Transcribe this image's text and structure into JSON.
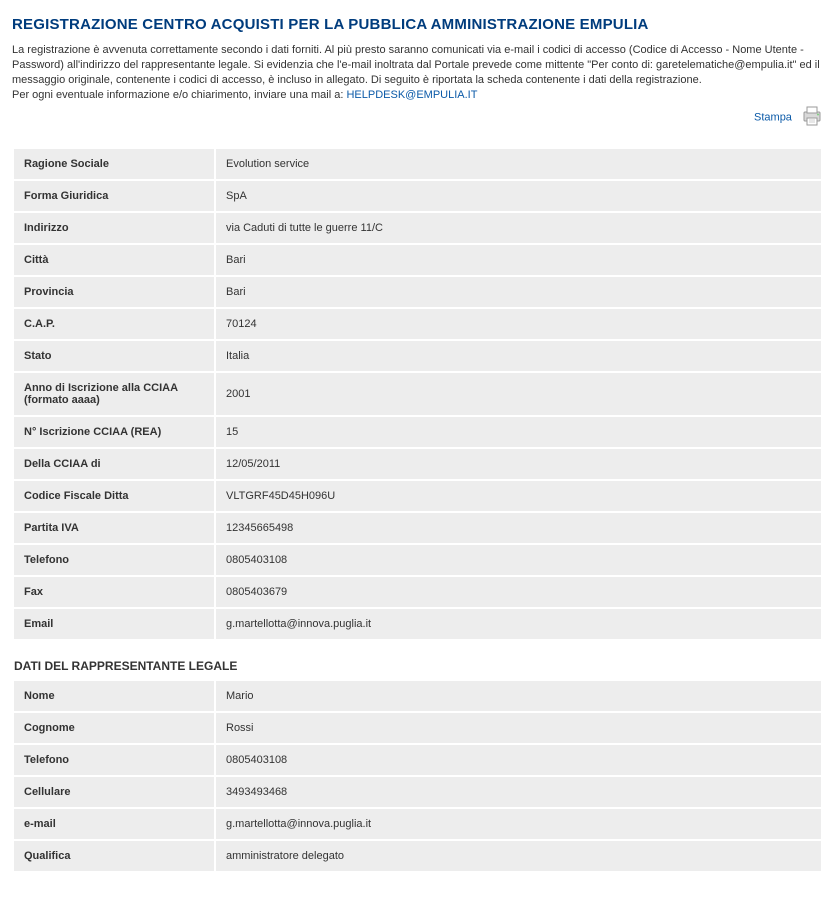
{
  "title": "REGISTRAZIONE CENTRO ACQUISTI PER LA PUBBLICA AMMINISTRAZIONE EMPULIA",
  "intro": {
    "p1": "La registrazione è avvenuta correttamente secondo i dati forniti. Al più presto saranno comunicati via e-mail i codici di accesso (Codice di Accesso - Nome Utente - Password) all'indirizzo del rappresentante legale. Si evidenzia che l'e-mail inoltrata dal Portale prevede come mittente \"Per conto di: garetelematiche@empulia.it\" ed il messaggio originale, contenente i codici di accesso, è incluso in allegato. Di seguito è riportata la scheda contenente i dati della registrazione.",
    "p2a": "Per ogni eventuale informazione e/o chiarimento, inviare una mail a: ",
    "p2_link": "HELPDESK@EMPULIA.IT"
  },
  "print_label": "Stampa",
  "company": {
    "rows": [
      {
        "label": "Ragione Sociale",
        "value": "Evolution service"
      },
      {
        "label": "Forma Giuridica",
        "value": "SpA"
      },
      {
        "label": "Indirizzo",
        "value": "via Caduti di tutte le guerre 11/C"
      },
      {
        "label": "Città",
        "value": "Bari"
      },
      {
        "label": "Provincia",
        "value": "Bari"
      },
      {
        "label": "C.A.P.",
        "value": "70124"
      },
      {
        "label": "Stato",
        "value": "Italia"
      },
      {
        "label": "Anno di Iscrizione alla CCIAA (formato aaaa)",
        "value": "2001"
      },
      {
        "label": "N° Iscrizione CCIAA (REA)",
        "value": "15"
      },
      {
        "label": "Della CCIAA di",
        "value": "12/05/2011"
      },
      {
        "label": "Codice Fiscale Ditta",
        "value": "VLTGRF45D45H096U"
      },
      {
        "label": "Partita IVA",
        "value": "12345665498"
      },
      {
        "label": "Telefono",
        "value": "0805403108"
      },
      {
        "label": "Fax",
        "value": "0805403679"
      },
      {
        "label": "Email",
        "value": "g.martellotta@innova.puglia.it"
      }
    ]
  },
  "legal_section_title": "DATI DEL RAPPRESENTANTE LEGALE",
  "legal": {
    "rows": [
      {
        "label": "Nome",
        "value": "Mario"
      },
      {
        "label": "Cognome",
        "value": "Rossi"
      },
      {
        "label": "Telefono",
        "value": "0805403108"
      },
      {
        "label": "Cellulare",
        "value": "3493493468"
      },
      {
        "label": "e-mail",
        "value": "g.martellotta@innova.puglia.it"
      },
      {
        "label": "Qualifica",
        "value": "amministratore delegato"
      }
    ]
  }
}
